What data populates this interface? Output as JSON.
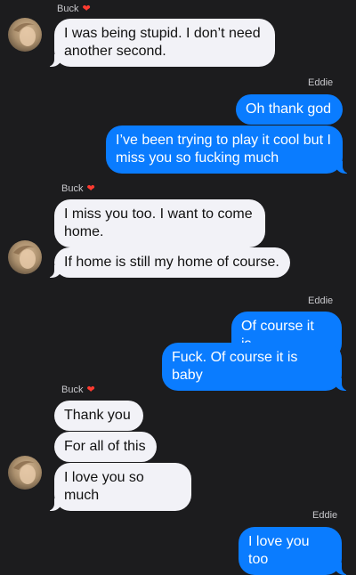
{
  "colors": {
    "background": "#1c1c1e",
    "incoming_bubble": "#f2f2f7",
    "outgoing_bubble": "#0a7cff",
    "heart": "#ff3b30"
  },
  "thread": {
    "group1": {
      "sender": "Buck",
      "heart": "❤️",
      "messages": [
        "I was being stupid. I don’t need another second."
      ]
    },
    "group2": {
      "sender": "Eddie",
      "messages": [
        "Oh thank god",
        "I’ve been trying to play it cool but I miss you so fucking much"
      ]
    },
    "group3": {
      "sender": "Buck",
      "heart": "❤️",
      "messages": [
        "I miss you too. I want to come home.",
        "If home is still my home of course."
      ]
    },
    "group4": {
      "sender": "Eddie",
      "messages": [
        "Of course it is.",
        "Fuck. Of course it is baby"
      ]
    },
    "group5": {
      "sender": "Buck",
      "heart": "❤️",
      "messages": [
        "Thank you",
        "For all of this",
        "I love you so much"
      ]
    },
    "group6": {
      "sender": "Eddie",
      "messages": [
        "I love you too"
      ]
    }
  }
}
